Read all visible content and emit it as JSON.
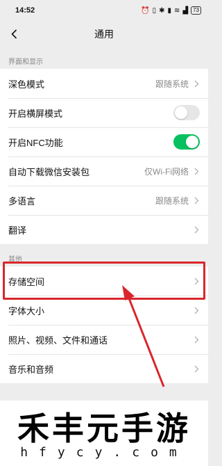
{
  "status_bar": {
    "time": "14:52",
    "battery": "73"
  },
  "header": {
    "title": "通用"
  },
  "section_display": {
    "label": "界面和显示",
    "items": [
      {
        "label": "深色模式",
        "value": "跟随系统"
      },
      {
        "label": "开启横屏模式",
        "toggle": "off"
      },
      {
        "label": "开启NFC功能",
        "toggle": "on"
      },
      {
        "label": "自动下载微信安装包",
        "value": "仅Wi-Fi网络"
      },
      {
        "label": "多语言",
        "value": "跟随系统"
      },
      {
        "label": "翻译"
      }
    ]
  },
  "section_other": {
    "label": "其他",
    "items": [
      {
        "label": "存储空间"
      },
      {
        "label": "字体大小"
      },
      {
        "label": "照片、视频、文件和通话"
      },
      {
        "label": "音乐和音频"
      }
    ]
  },
  "watermark": {
    "title": "禾丰元手游",
    "domain": "hfycy.com"
  },
  "colors": {
    "accent_green": "#07c160",
    "highlight_red": "#d9262c",
    "background": "#ededed"
  }
}
